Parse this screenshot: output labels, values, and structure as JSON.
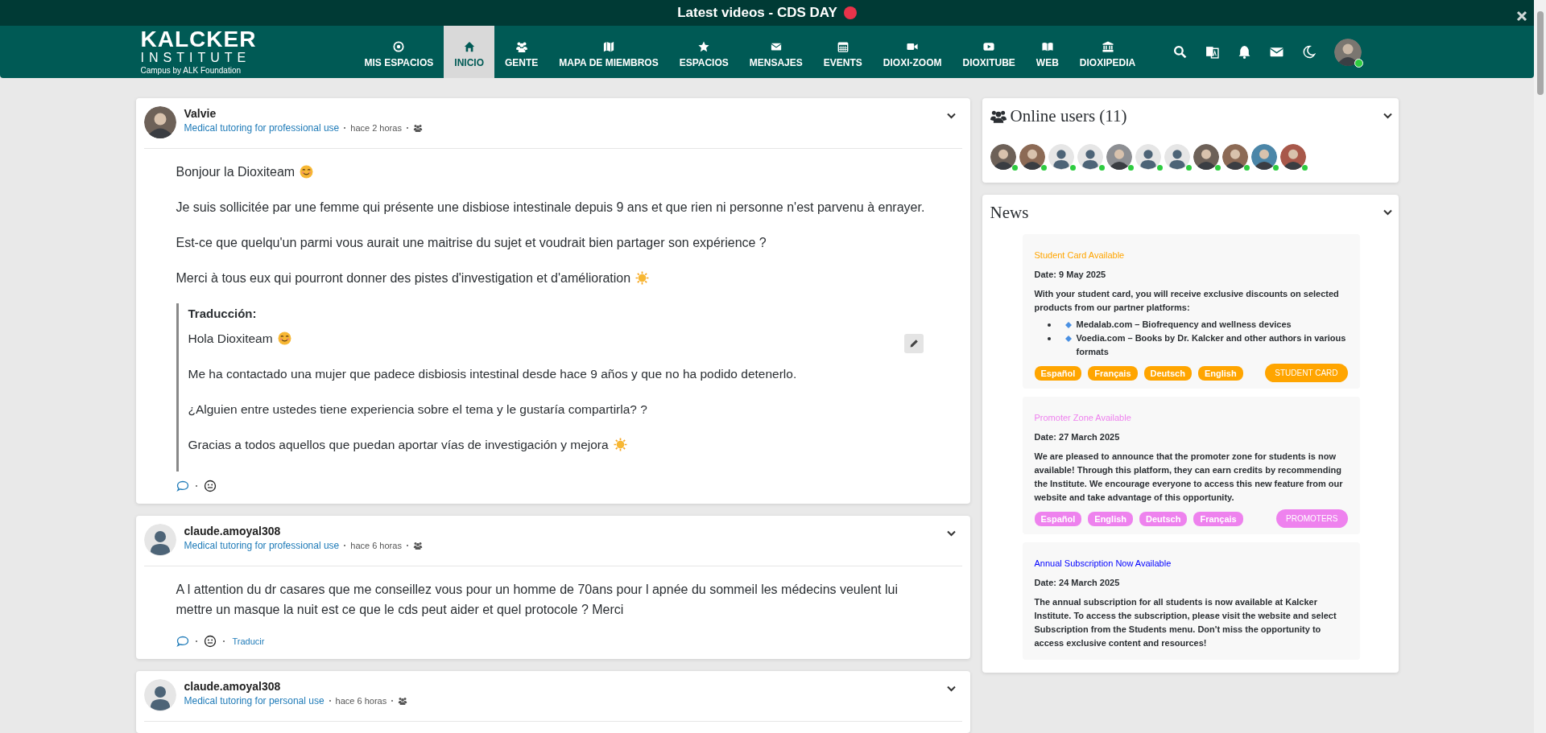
{
  "banner": {
    "text": "Latest videos - CDS DAY"
  },
  "brand": {
    "name": "KALCKER",
    "sub": "INSTITUTE",
    "tagline": "Campus by ALK Foundation"
  },
  "nav": [
    {
      "label": "MIS ESPACIOS",
      "selected": false
    },
    {
      "label": "INICIO",
      "selected": true
    },
    {
      "label": "GENTE",
      "selected": false
    },
    {
      "label": "MAPA DE MIEMBROS",
      "selected": false
    },
    {
      "label": "ESPACIOS",
      "selected": false
    },
    {
      "label": "MENSAJES",
      "selected": false
    },
    {
      "label": "EVENTS",
      "selected": false
    },
    {
      "label": "DIOXI-ZOOM",
      "selected": false
    },
    {
      "label": "DIOXITUBE",
      "selected": false
    },
    {
      "label": "WEB",
      "selected": false
    },
    {
      "label": "DIOXIPEDIA",
      "selected": false
    }
  ],
  "feed": [
    {
      "author": "Valvie",
      "avatar": {
        "kind": "photo"
      },
      "group": "Medical tutoring for professional use",
      "time": "hace 2 horas",
      "paragraphs": [
        {
          "text": "Bonjour la Dioxiteam",
          "emoji": {
            "kind": "smile"
          }
        },
        {
          "text": "Je suis sollicitée par une femme qui présente une disbiose intestinale depuis 9 ans et que rien ni personne n'est parvenu à enrayer."
        },
        {
          "text": "Est-ce que quelqu'un parmi vous aurait une maitrise du sujet et voudrait bien partager son expérience ?"
        },
        {
          "text": "Merci à tous eux qui pourront donner des pistes d'investigation et d'amélioration",
          "emoji": {
            "kind": "sun"
          }
        }
      ],
      "translation": {
        "heading": "Traducción:",
        "paragraphs": [
          {
            "text": "Hola Dioxiteam",
            "emoji": {
              "kind": "smile"
            }
          },
          {
            "text": "Me ha contactado una mujer que padece disbiosis intestinal desde hace 9 años y que no ha podido detenerlo."
          },
          {
            "text": "¿Alguien entre ustedes tiene experiencia sobre el tema y le gustaría compartirla? ?"
          },
          {
            "text": "Gracias a todos aquellos que puedan aportar vías de investigación y mejora",
            "emoji": {
              "kind": "sun"
            }
          }
        ]
      }
    },
    {
      "author": "claude.amoyal308",
      "avatar": {
        "kind": "default"
      },
      "group": "Medical tutoring for professional use",
      "time": "hace 6 horas",
      "paragraphs": [
        {
          "text": "A l attention du dr casares que me conseillez vous pour un homme de 70ans pour l apnée du sommeil les médecins veulent lui mettre un masque la nuit est ce que le cds peut aider et quel protocole ? Merci"
        }
      ],
      "translate": "Traducir"
    },
    {
      "author": "claude.amoyal308",
      "avatar": {
        "kind": "default"
      },
      "group": "Medical tutoring for personal use",
      "time": "hace 6 horas"
    }
  ],
  "online_users": {
    "title": "Online users (11)",
    "users": [
      {
        "kind": "photo"
      },
      {
        "kind": "photo"
      },
      {
        "kind": "default"
      },
      {
        "kind": "default"
      },
      {
        "kind": "photo"
      },
      {
        "kind": "default"
      },
      {
        "kind": "default"
      },
      {
        "kind": "photo"
      },
      {
        "kind": "photo"
      },
      {
        "kind": "photo"
      },
      {
        "kind": "photo"
      }
    ]
  },
  "news": {
    "title": "News",
    "items": [
      {
        "title": "Student Card Available",
        "color": "#ffa500",
        "date": "Date: 9 May 2025",
        "body": "With your student card, you will receive exclusive discounts on selected products from our partner platforms:",
        "bullets": [
          "Medalab.com – Biofrequency and wellness devices",
          "Voedia.com – Books by Dr. Kalcker and other authors in various formats"
        ],
        "tags": [
          "Español",
          "Français",
          "Deutsch",
          "English"
        ],
        "button": "STUDENT CARD"
      },
      {
        "title": "Promoter Zone Available",
        "color": "#ee82ee",
        "date": "Date: 27 March 2025",
        "body": "We are pleased to announce that the promoter zone for students is now available! Through this platform, they can earn credits by recommending the Institute. We encourage everyone to access this new feature from our website and take advantage of this opportunity.",
        "tags": [
          "Español",
          "English",
          "Deutsch",
          "Français"
        ],
        "button": "PROMOTERS"
      },
      {
        "title": "Annual Subscription Now Available",
        "color": "#0000ff",
        "date": "Date: 24 March 2025",
        "body": "The annual subscription for all students is now available at Kalcker Institute. To access the subscription, please visit the website and select Subscription from the Students menu. Don't miss the opportunity to access exclusive content and resources!"
      }
    ]
  }
}
